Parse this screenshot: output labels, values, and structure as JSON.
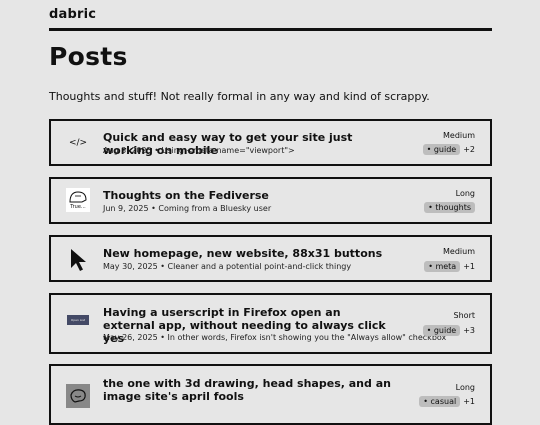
{
  "site": {
    "name": "dabric"
  },
  "page": {
    "title": "Posts",
    "intro": "Thoughts and stuff! Not really formal in any way and kind of scrappy."
  },
  "posts": [
    {
      "icon": "code-icon",
      "icon_text": "</>",
      "title": "Quick and easy way to get your site just working on mobile",
      "meta": "Aug 3, 2025 • Using <meta name=\"viewport\">",
      "length": "Medium",
      "tag": "• guide",
      "more": "+2"
    },
    {
      "icon": "true-meme-icon",
      "icon_text": "True...",
      "title": "Thoughts on the Fediverse",
      "meta": "Jun 9, 2025 • Coming from a Bluesky user",
      "length": "Long",
      "tag": "• thoughts",
      "more": ""
    },
    {
      "icon": "cursor-icon",
      "title": "New homepage, new website, 88x31 buttons",
      "meta": "May 30, 2025 • Cleaner and a potential point-and-click thingy",
      "length": "Medium",
      "tag": "• meta",
      "more": "+1"
    },
    {
      "icon": "open-in-app-button-icon",
      "icon_text": "Open List",
      "title": "Having a userscript in Firefox open an external app, without needing to always click yes",
      "meta": "May 26, 2025 • In other words, Firefox isn't showing you the \"Always allow\" checkbox",
      "length": "Short",
      "tag": "• guide",
      "more": "+3"
    },
    {
      "icon": "head-drawing-icon",
      "title": "the one with 3d drawing, head shapes, and an image site's april fools",
      "meta": "",
      "length": "Long",
      "tag": "• casual",
      "more": "+1"
    }
  ]
}
